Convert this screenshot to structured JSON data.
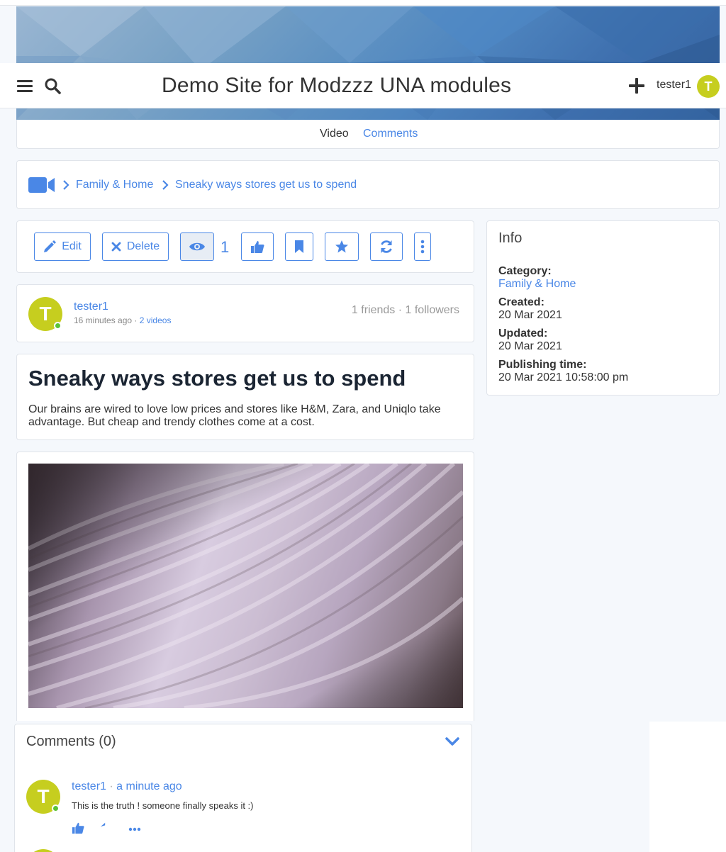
{
  "header": {
    "site_title": "Demo Site for Modzzz UNA modules",
    "username": "tester1",
    "avatar_letter": "T"
  },
  "tabs": [
    {
      "label": "Video"
    },
    {
      "label": "Comments"
    }
  ],
  "breadcrumb": {
    "items": [
      {
        "label": "Family & Home"
      },
      {
        "label": "Sneaky ways stores get us to spend"
      }
    ]
  },
  "actions": {
    "edit_label": "Edit",
    "delete_label": "Delete",
    "view_count": "1"
  },
  "author": {
    "name": "tester1",
    "avatar_letter": "T",
    "time": "16 minutes ago",
    "videos": "2 videos",
    "friends": "1 friends",
    "followers": "1 followers"
  },
  "post": {
    "title": "Sneaky ways stores get us to spend",
    "description": "Our brains are wired to love low prices and stores like H&M, Zara, and Uniqlo take advantage. But cheap and trendy clothes come at a cost."
  },
  "info": {
    "title": "Info",
    "category_label": "Category:",
    "category_value": "Family & Home",
    "created_label": "Created:",
    "created_value": "20 Mar 2021",
    "updated_label": "Updated:",
    "updated_value": "20 Mar 2021",
    "publishing_label": "Publishing time:",
    "publishing_value": "20 Mar 2021 10:58:00 pm"
  },
  "comments": {
    "title": "Comments (0)",
    "items": [
      {
        "author": "tester1",
        "avatar_letter": "T",
        "time": "a minute ago",
        "text": "This is the truth ! someone finally speaks it :)"
      }
    ]
  },
  "colors": {
    "accent": "#4a87e6",
    "avatar": "#c6ce1f",
    "online": "#5bc236"
  }
}
